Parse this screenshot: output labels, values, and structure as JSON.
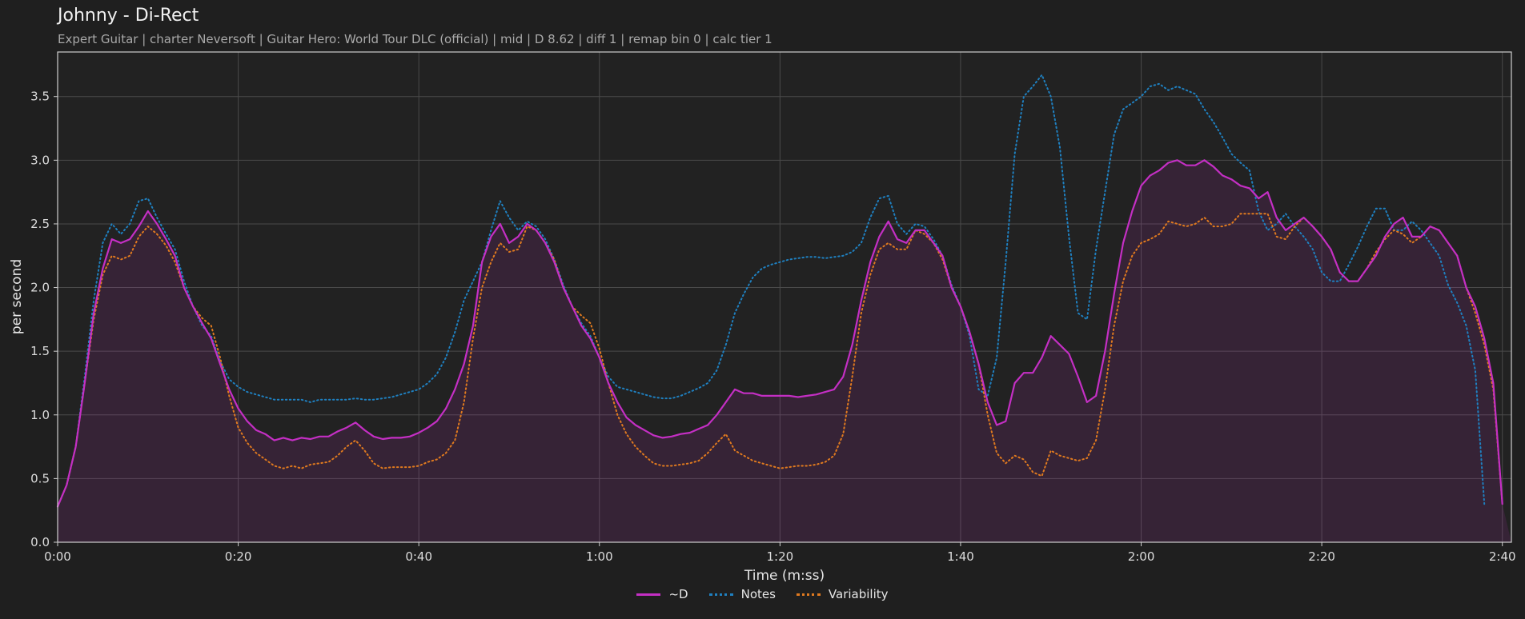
{
  "header": {
    "title": "Johnny - Di-Rect",
    "subtitle": "Expert Guitar  |  charter Neversoft  |  Guitar Hero: World Tour DLC (official)  |  mid  |  D 8.62  |  diff 1  |  remap bin 0  |  calc tier 1"
  },
  "chart_data": {
    "type": "line",
    "xlabel": "Time (m:ss)",
    "ylabel": "per second",
    "xlim": [
      0,
      161
    ],
    "ylim": [
      0,
      3.85
    ],
    "x_ticks": [
      0,
      20,
      40,
      60,
      80,
      100,
      120,
      140,
      160
    ],
    "x_tick_labels": [
      "0:00",
      "0:20",
      "0:40",
      "1:00",
      "1:20",
      "1:40",
      "2:00",
      "2:20",
      "2:40"
    ],
    "y_ticks": [
      0.0,
      0.5,
      1.0,
      1.5,
      2.0,
      2.5,
      3.0,
      3.5
    ],
    "y_tick_labels": [
      "0.0",
      "0.5",
      "1.0",
      "1.5",
      "2.0",
      "2.5",
      "3.0",
      "3.5"
    ],
    "grid": true,
    "legend_position": "bottom-center",
    "x": [
      0,
      1,
      2,
      3,
      4,
      5,
      6,
      7,
      8,
      9,
      10,
      11,
      12,
      13,
      14,
      15,
      16,
      17,
      18,
      19,
      20,
      21,
      22,
      23,
      24,
      25,
      26,
      27,
      28,
      29,
      30,
      31,
      32,
      33,
      34,
      35,
      36,
      37,
      38,
      39,
      40,
      41,
      42,
      43,
      44,
      45,
      46,
      47,
      48,
      49,
      50,
      51,
      52,
      53,
      54,
      55,
      56,
      57,
      58,
      59,
      60,
      61,
      62,
      63,
      64,
      65,
      66,
      67,
      68,
      69,
      70,
      71,
      72,
      73,
      74,
      75,
      76,
      77,
      78,
      79,
      80,
      81,
      82,
      83,
      84,
      85,
      86,
      87,
      88,
      89,
      90,
      91,
      92,
      93,
      94,
      95,
      96,
      97,
      98,
      99,
      100,
      101,
      102,
      103,
      104,
      105,
      106,
      107,
      108,
      109,
      110,
      111,
      112,
      113,
      114,
      115,
      116,
      117,
      118,
      119,
      120,
      121,
      122,
      123,
      124,
      125,
      126,
      127,
      128,
      129,
      130,
      131,
      132,
      133,
      134,
      135,
      136,
      137,
      138,
      139,
      140,
      141,
      142,
      143,
      144,
      145,
      146,
      147,
      148,
      149,
      150,
      151,
      152,
      153,
      154,
      155,
      156,
      157,
      158,
      159,
      160,
      161
    ],
    "series": [
      {
        "name": "~D",
        "color": "#c42fc4",
        "style": "solid",
        "fill": true,
        "values": [
          0.28,
          0.45,
          0.75,
          1.25,
          1.8,
          2.15,
          2.38,
          2.35,
          2.38,
          2.48,
          2.6,
          2.5,
          2.38,
          2.25,
          2.0,
          1.85,
          1.72,
          1.6,
          1.4,
          1.2,
          1.05,
          0.95,
          0.88,
          0.85,
          0.8,
          0.82,
          0.8,
          0.82,
          0.81,
          0.83,
          0.83,
          0.87,
          0.9,
          0.94,
          0.88,
          0.83,
          0.81,
          0.82,
          0.82,
          0.83,
          0.86,
          0.9,
          0.95,
          1.05,
          1.2,
          1.4,
          1.7,
          2.2,
          2.4,
          2.5,
          2.35,
          2.4,
          2.5,
          2.45,
          2.35,
          2.2,
          2.0,
          1.85,
          1.7,
          1.6,
          1.45,
          1.25,
          1.1,
          0.98,
          0.92,
          0.88,
          0.84,
          0.82,
          0.83,
          0.85,
          0.86,
          0.89,
          0.92,
          1.0,
          1.1,
          1.2,
          1.17,
          1.17,
          1.15,
          1.15,
          1.15,
          1.15,
          1.14,
          1.15,
          1.16,
          1.18,
          1.2,
          1.3,
          1.55,
          1.9,
          2.2,
          2.4,
          2.52,
          2.38,
          2.35,
          2.45,
          2.45,
          2.35,
          2.25,
          2.0,
          1.85,
          1.65,
          1.4,
          1.1,
          0.92,
          0.95,
          1.25,
          1.33,
          1.33,
          1.45,
          1.62,
          1.55,
          1.48,
          1.3,
          1.1,
          1.15,
          1.5,
          1.95,
          2.35,
          2.6,
          2.8,
          2.88,
          2.92,
          2.98,
          3.0,
          2.96,
          2.96,
          3.0,
          2.95,
          2.88,
          2.85,
          2.8,
          2.78,
          2.7,
          2.75,
          2.55,
          2.45,
          2.5,
          2.55,
          2.48,
          2.4,
          2.3,
          2.12,
          2.05,
          2.05,
          2.15,
          2.25,
          2.4,
          2.5,
          2.55,
          2.4,
          2.4,
          2.48,
          2.45,
          2.35,
          2.25,
          2.0,
          1.85,
          1.6,
          1.25,
          0.3
        ]
      },
      {
        "name": "Notes",
        "color": "#1f80c0",
        "style": "dotted",
        "fill": false,
        "values": [
          0.28,
          0.45,
          0.75,
          1.3,
          1.9,
          2.35,
          2.5,
          2.42,
          2.5,
          2.68,
          2.7,
          2.55,
          2.42,
          2.3,
          2.05,
          1.85,
          1.7,
          1.62,
          1.42,
          1.28,
          1.22,
          1.18,
          1.16,
          1.14,
          1.12,
          1.12,
          1.12,
          1.12,
          1.1,
          1.12,
          1.12,
          1.12,
          1.12,
          1.13,
          1.12,
          1.12,
          1.13,
          1.14,
          1.16,
          1.18,
          1.2,
          1.25,
          1.32,
          1.45,
          1.65,
          1.9,
          2.05,
          2.2,
          2.45,
          2.68,
          2.55,
          2.45,
          2.52,
          2.48,
          2.38,
          2.22,
          2.02,
          1.85,
          1.72,
          1.62,
          1.45,
          1.3,
          1.22,
          1.2,
          1.18,
          1.16,
          1.14,
          1.13,
          1.13,
          1.15,
          1.18,
          1.21,
          1.25,
          1.35,
          1.55,
          1.8,
          1.95,
          2.08,
          2.15,
          2.18,
          2.2,
          2.22,
          2.23,
          2.24,
          2.24,
          2.23,
          2.24,
          2.25,
          2.28,
          2.35,
          2.55,
          2.7,
          2.72,
          2.5,
          2.42,
          2.5,
          2.48,
          2.38,
          2.25,
          2.02,
          1.85,
          1.62,
          1.2,
          1.15,
          1.45,
          2.2,
          3.05,
          3.5,
          3.58,
          3.67,
          3.5,
          3.1,
          2.4,
          1.8,
          1.75,
          2.3,
          2.75,
          3.2,
          3.4,
          3.45,
          3.5,
          3.58,
          3.6,
          3.55,
          3.58,
          3.55,
          3.52,
          3.4,
          3.3,
          3.18,
          3.05,
          2.98,
          2.92,
          2.6,
          2.45,
          2.5,
          2.58,
          2.48,
          2.4,
          2.3,
          2.12,
          2.05,
          2.05,
          2.18,
          2.32,
          2.48,
          2.62,
          2.62,
          2.45,
          2.45,
          2.52,
          2.45,
          2.35,
          2.25,
          2.02,
          1.88,
          1.7,
          1.35,
          0.3
        ]
      },
      {
        "name": "Variability",
        "color": "#e07a1f",
        "style": "dotted",
        "fill": false,
        "values": [
          0.28,
          0.45,
          0.75,
          1.25,
          1.75,
          2.1,
          2.25,
          2.22,
          2.25,
          2.4,
          2.48,
          2.42,
          2.33,
          2.2,
          2.0,
          1.85,
          1.76,
          1.7,
          1.45,
          1.15,
          0.9,
          0.78,
          0.7,
          0.65,
          0.6,
          0.58,
          0.6,
          0.58,
          0.61,
          0.62,
          0.63,
          0.68,
          0.75,
          0.8,
          0.72,
          0.62,
          0.58,
          0.59,
          0.59,
          0.59,
          0.6,
          0.63,
          0.65,
          0.7,
          0.8,
          1.1,
          1.6,
          2.0,
          2.2,
          2.35,
          2.28,
          2.3,
          2.48,
          2.45,
          2.35,
          2.22,
          2.0,
          1.85,
          1.78,
          1.72,
          1.52,
          1.25,
          1.0,
          0.85,
          0.75,
          0.68,
          0.62,
          0.6,
          0.6,
          0.61,
          0.62,
          0.64,
          0.7,
          0.78,
          0.85,
          0.72,
          0.68,
          0.64,
          0.62,
          0.6,
          0.58,
          0.59,
          0.6,
          0.6,
          0.61,
          0.63,
          0.68,
          0.85,
          1.3,
          1.8,
          2.1,
          2.3,
          2.35,
          2.3,
          2.3,
          2.45,
          2.42,
          2.35,
          2.22,
          2.0,
          1.85,
          1.65,
          1.4,
          1.0,
          0.7,
          0.62,
          0.68,
          0.65,
          0.55,
          0.52,
          0.72,
          0.68,
          0.66,
          0.64,
          0.66,
          0.8,
          1.2,
          1.7,
          2.05,
          2.25,
          2.35,
          2.38,
          2.42,
          2.52,
          2.5,
          2.48,
          2.5,
          2.55,
          2.48,
          2.48,
          2.5,
          2.58,
          2.58,
          2.58,
          2.58,
          2.4,
          2.38,
          2.48,
          2.55,
          2.48,
          2.4,
          2.3,
          2.12,
          2.05,
          2.05,
          2.15,
          2.28,
          2.38,
          2.45,
          2.42,
          2.35,
          2.4,
          2.48,
          2.45,
          2.35,
          2.25,
          2.0,
          1.8,
          1.55,
          1.2,
          0.3
        ]
      }
    ]
  }
}
